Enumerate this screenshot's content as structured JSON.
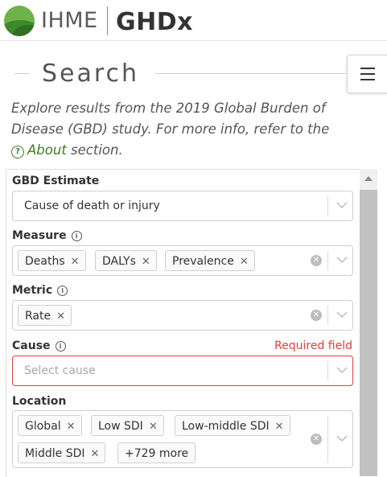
{
  "header": {
    "logo_ihme": "IHME",
    "logo_ghdx": "GHDx"
  },
  "search": {
    "title": "Search",
    "intro_text": "Explore results from the 2019 Global Burden of Disease (GBD) study. For more info, refer to the",
    "about_link": "About",
    "intro_suffix": "section."
  },
  "form": {
    "gbd_estimate": {
      "label": "GBD Estimate",
      "value": "Cause of death or injury"
    },
    "measure": {
      "label": "Measure",
      "chips": [
        "Deaths",
        "DALYs",
        "Prevalence"
      ]
    },
    "metric": {
      "label": "Metric",
      "chips": [
        "Rate"
      ]
    },
    "cause": {
      "label": "Cause",
      "required": "Required field",
      "placeholder": "Select cause"
    },
    "location": {
      "label": "Location",
      "chips": [
        "Global",
        "Low SDI",
        "Low-middle SDI",
        "Middle SDI",
        "+729 more"
      ]
    }
  },
  "colors": {
    "accent_green": "#3c7d28",
    "error_red": "#e0413e",
    "scroll_thumb": "#c1c1c1"
  },
  "icons": {
    "menu": "hamburger-icon",
    "help": "question-circle-icon",
    "info": "info-circle-icon",
    "dropdown": "chevron-down-icon",
    "clear": "clear-circle-icon",
    "chip_remove": "close-icon"
  }
}
